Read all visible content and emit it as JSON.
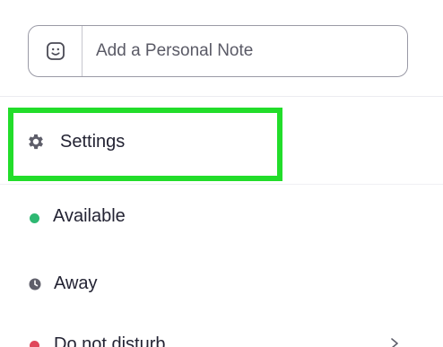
{
  "note": {
    "placeholder": "Add a Personal Note",
    "emoji_icon": "smiley-icon"
  },
  "menu": {
    "settings": {
      "label": "Settings",
      "icon": "gear-icon"
    },
    "available": {
      "label": "Available",
      "status_color": "#2eb872"
    },
    "away": {
      "label": "Away",
      "icon": "clock-icon",
      "icon_color": "#5e5e6a"
    },
    "do_not_disturb": {
      "label": "Do not disturb",
      "status_color": "#e0465a",
      "icon": "chevron-right-icon"
    }
  },
  "highlight": {
    "target": "settings",
    "color": "#22dd2a"
  }
}
